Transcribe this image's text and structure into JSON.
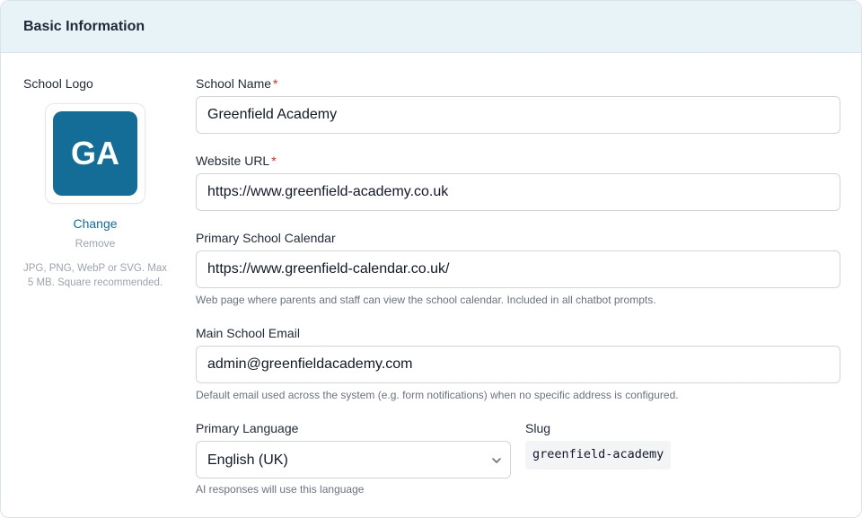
{
  "section": {
    "title": "Basic Information"
  },
  "logo": {
    "label": "School Logo",
    "initials": "GA",
    "tile_color": "#136d96",
    "change_label": "Change",
    "remove_label": "Remove",
    "help_text": "JPG, PNG, WebP or SVG. Max 5 MB. Square recommended."
  },
  "fields": {
    "school_name": {
      "label": "School Name",
      "required_mark": "*",
      "value": "Greenfield Academy"
    },
    "website_url": {
      "label": "Website URL",
      "required_mark": "*",
      "value": "https://www.greenfield-academy.co.uk"
    },
    "calendar": {
      "label": "Primary School Calendar",
      "value": "https://www.greenfield-calendar.co.uk/",
      "help": "Web page where parents and staff can view the school calendar. Included in all chatbot prompts."
    },
    "email": {
      "label": "Main School Email",
      "value": "admin@greenfieldacademy.com",
      "help": "Default email used across the system (e.g. form notifications) when no specific address is configured."
    },
    "language": {
      "label": "Primary Language",
      "selected": "English (UK)",
      "help": "AI responses will use this language",
      "icon": "chevron-down-icon"
    },
    "slug": {
      "label": "Slug",
      "value": "greenfield-academy"
    }
  },
  "colors": {
    "accent": "#136d96",
    "header_bg": "#e8f3f7",
    "required": "#dc2626"
  }
}
